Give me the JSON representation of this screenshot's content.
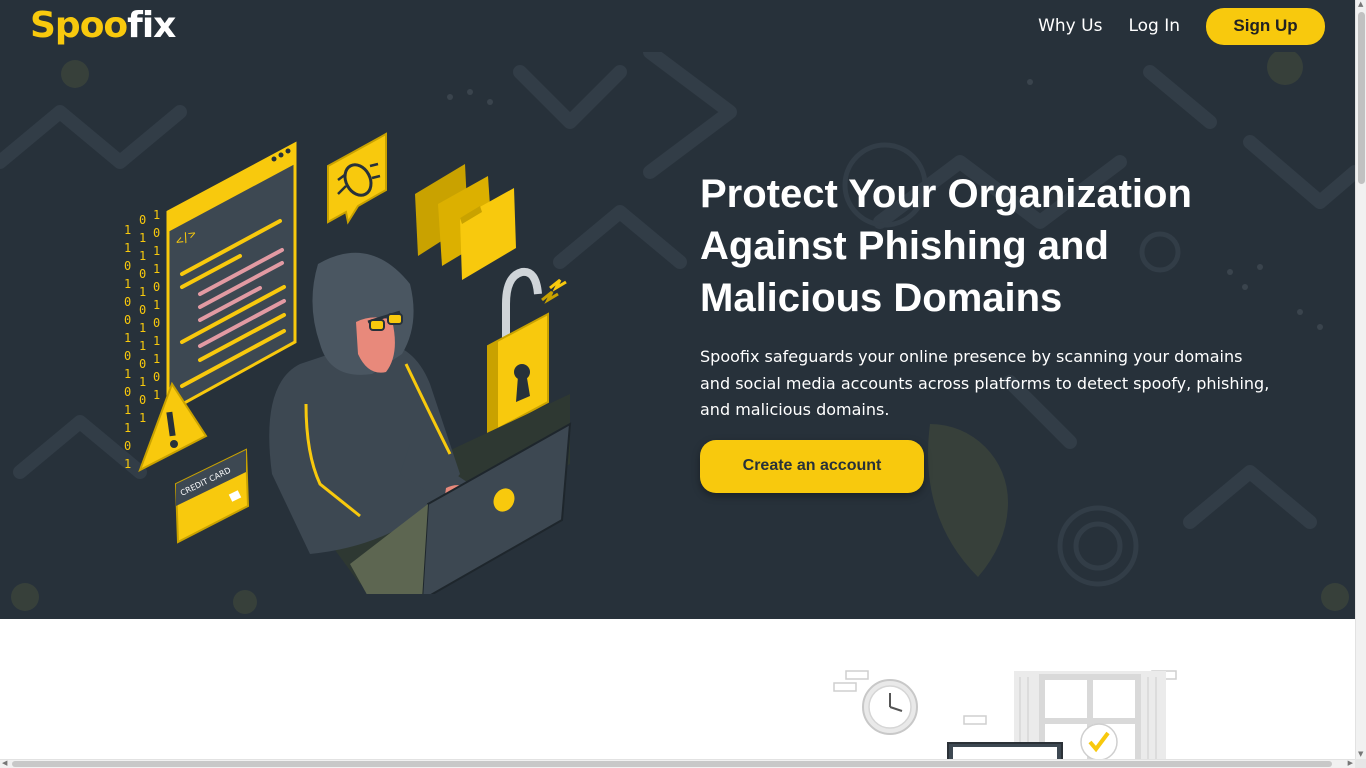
{
  "brand": {
    "logo_part1": "Spoo",
    "logo_part2": "fix"
  },
  "nav": {
    "why_us": "Why Us",
    "log_in": "Log In",
    "sign_up": "Sign Up"
  },
  "hero": {
    "title": "Protect Your Organization Against Phishing and Malicious Domains",
    "description": "Spoofix safeguards your online presence by scanning your domains and social media accounts across platforms to detect spoofy, phishing, and malicious domains.",
    "cta": "Create an account",
    "illustration_text": {
      "credit_card": "CREDIT CARD",
      "code_tag": "</>"
    }
  },
  "colors": {
    "accent": "#f8c90d",
    "hero_bg": "#27313a",
    "text_light": "#ffffff"
  },
  "icons": [
    "hacker-illustration",
    "bug-icon",
    "padlock-icon",
    "warning-icon",
    "folder-icon",
    "credit-card-icon",
    "clock-icon",
    "checkmark-icon"
  ]
}
